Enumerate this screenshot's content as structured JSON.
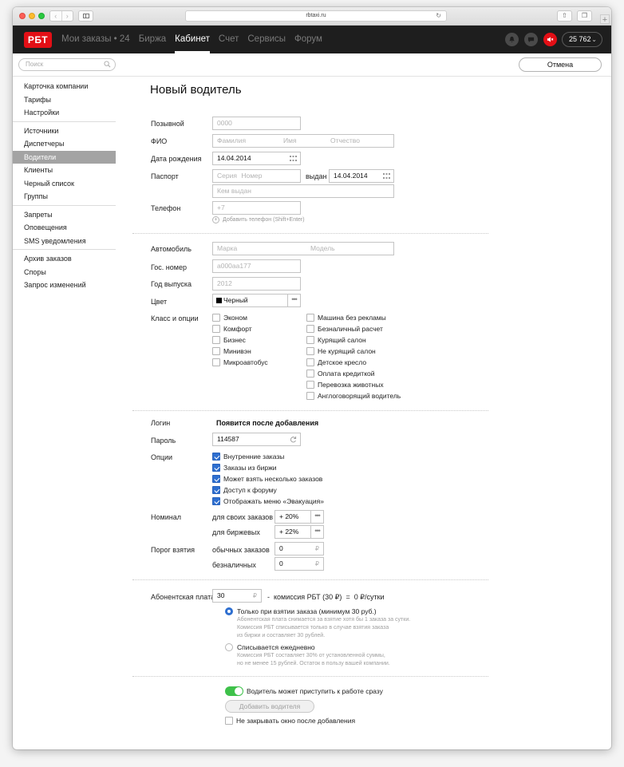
{
  "browser": {
    "url": "rbtaxi.ru"
  },
  "nav": {
    "logo": "РБТ",
    "links": [
      "Мои заказы • 24",
      "Биржа",
      "Кабинет",
      "Счет",
      "Сервисы",
      "Форум"
    ],
    "balance": "25 762"
  },
  "toolbar": {
    "search_placeholder": "Поиск",
    "cancel_label": "Отмена"
  },
  "sidebar": {
    "groups": [
      [
        "Карточка компании",
        "Тарифы",
        "Настройки"
      ],
      [
        "Источники",
        "Диспетчеры",
        "Водители",
        "Клиенты",
        "Черный список",
        "Группы"
      ],
      [
        "Запреты",
        "Оповещения",
        "SMS уведомления"
      ],
      [
        "Архив заказов",
        "Споры",
        "Запрос изменений"
      ]
    ],
    "active": "Водители"
  },
  "form": {
    "title": "Новый водитель",
    "callsign": {
      "label": "Позывной",
      "placeholder": "0000"
    },
    "fio": {
      "label": "ФИО",
      "ph_last": "Фамилия",
      "ph_first": "Имя",
      "ph_middle": "Отчество"
    },
    "birth": {
      "label": "Дата рождения",
      "value": "14.04.2014"
    },
    "passport": {
      "label": "Паспорт",
      "ph_series": "Серия",
      "ph_number": "Номер",
      "issued_label": "выдан",
      "issued_date": "14.04.2014",
      "ph_issued_by": "Кем выдан"
    },
    "phone": {
      "label": "Телефон",
      "placeholder": "+7",
      "add_phone": "Добавить телефон (Shift+Enter)"
    },
    "car": {
      "label": "Автомобиль",
      "ph_brand": "Марка",
      "ph_model": "Модель"
    },
    "plate": {
      "label": "Гос. номер",
      "placeholder": "а000аа177"
    },
    "year": {
      "label": "Год выпуска",
      "placeholder": "2012"
    },
    "color": {
      "label": "Цвет",
      "value": "Черный",
      "swatch": "#000000"
    },
    "class_label": "Класс и опции",
    "classes_left": [
      "Эконом",
      "Комфорт",
      "Бизнес",
      "Минивэн",
      "Микроавтобус"
    ],
    "classes_right": [
      "Машина без рекламы",
      "Безналичный расчет",
      "Курящий салон",
      "Не курящий салон",
      "Детское кресло",
      "Оплата кредиткой",
      "Перевозка животных",
      "Англоговорящий водитель"
    ],
    "login": {
      "label": "Логин",
      "value": "Появится после добавления"
    },
    "password": {
      "label": "Пароль",
      "value": "114587"
    },
    "options_label": "Опции",
    "options": [
      "Внутренние заказы",
      "Заказы из биржи",
      "Может взять несколько заказов",
      "Доступ к форуму",
      "Отображать меню «Эвакуация»"
    ],
    "nominal": {
      "label": "Номинал",
      "own_label": "для своих заказов",
      "own_value": "+ 20%",
      "exchange_label": "для биржевых",
      "exchange_value": "+ 22%"
    },
    "threshold": {
      "label": "Порог взятия",
      "regular_label": "обычных заказов",
      "regular_value": "0",
      "cashless_label": "безналичных",
      "cashless_value": "0",
      "currency": "₽"
    },
    "fee": {
      "label": "Абонентская плата",
      "value": "30",
      "formula_minus": "-",
      "commission_text": "комиссия РБТ (30 ₽)",
      "equals": "=",
      "result": "0 ₽/сутки",
      "option1_title": "Только при взятии заказа (минимум 30 руб.)",
      "option1_desc": [
        "Абонентская плата снимается за взятие хотя бы 1 заказа за сутки.",
        "Комиссия РБТ списывается только в случае взятия заказа",
        "из биржи и составляет 30 рублей."
      ],
      "option2_title": "Списывается ежедневно",
      "option2_desc": [
        "Комиссия РБТ составляет 30% от установленной суммы,",
        "но не менее 15 рублей. Остаток в пользу вашей компании."
      ]
    },
    "ready_toggle_label": "Водитель может приступить к работе сразу",
    "add_button": "Добавить водителя",
    "keep_open_label": "Не закрывать окно после добавления"
  },
  "colors": {
    "brand_red": "#e30f16",
    "nav_bg": "#1e1e1e",
    "checkbox_blue": "#2e6fd0",
    "toggle_green": "#3ec14a"
  }
}
